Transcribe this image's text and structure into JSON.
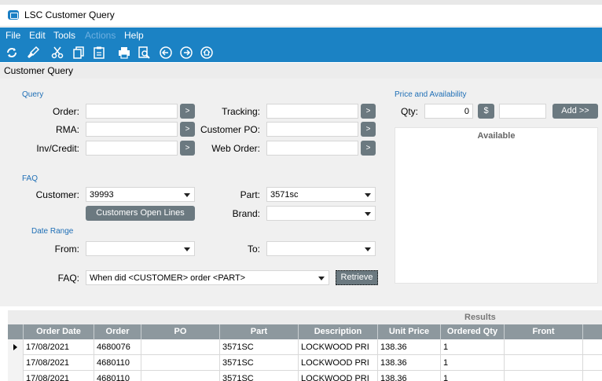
{
  "window": {
    "title": "LSC Customer Query"
  },
  "menu": {
    "file": "File",
    "edit": "Edit",
    "tools": "Tools",
    "actions": "Actions",
    "help": "Help"
  },
  "toolbar": [
    "refresh-icon",
    "clear-icon",
    "cut-icon",
    "copy-icon",
    "paste-icon",
    "print-icon",
    "print-preview-icon",
    "back-icon",
    "forward-icon",
    "home-icon"
  ],
  "header": {
    "title": "Customer Query"
  },
  "query": {
    "section_label": "Query",
    "order_label": "Order:",
    "order_value": "",
    "rma_label": "RMA:",
    "rma_value": "",
    "invcredit_label": "Inv/Credit:",
    "invcredit_value": "",
    "tracking_label": "Tracking:",
    "tracking_value": "",
    "customer_po_label": "Customer PO:",
    "customer_po_value": "",
    "web_order_label": "Web Order:",
    "web_order_value": "",
    "go_label": ">"
  },
  "faq": {
    "section_label": "FAQ",
    "customer_label": "Customer:",
    "customer_value": "39993",
    "part_label": "Part:",
    "part_value": "3571sc",
    "brand_label": "Brand:",
    "brand_value": "",
    "open_lines_button": "Customers Open Lines",
    "date_range_label": "Date Range",
    "from_label": "From:",
    "from_value": "",
    "to_label": "To:",
    "to_value": "",
    "faq_label": "FAQ:",
    "faq_value": "When did <CUSTOMER> order <PART>",
    "retrieve_button": "Retrieve"
  },
  "price": {
    "section_label": "Price and Availability",
    "qty_label": "Qty:",
    "qty_value": "0",
    "currency_button": "$",
    "price_value": "",
    "add_button": "Add >>",
    "available_label": "Available"
  },
  "results": {
    "title": "Results",
    "columns": [
      "Order Date",
      "Order",
      "PO",
      "Part",
      "Description",
      "Unit Price",
      "Ordered Qty",
      "Front"
    ],
    "rows": [
      [
        "17/08/2021",
        "4680076",
        "",
        "3571SC",
        "LOCKWOOD PRI",
        "138.36",
        "1",
        ""
      ],
      [
        "17/08/2021",
        "4680110",
        "",
        "3571SC",
        "LOCKWOOD PRI",
        "138.36",
        "1",
        ""
      ],
      [
        "17/08/2021",
        "4680110",
        "",
        "3571SC",
        "LOCKWOOD PRI",
        "138.36",
        "1",
        ""
      ]
    ]
  }
}
